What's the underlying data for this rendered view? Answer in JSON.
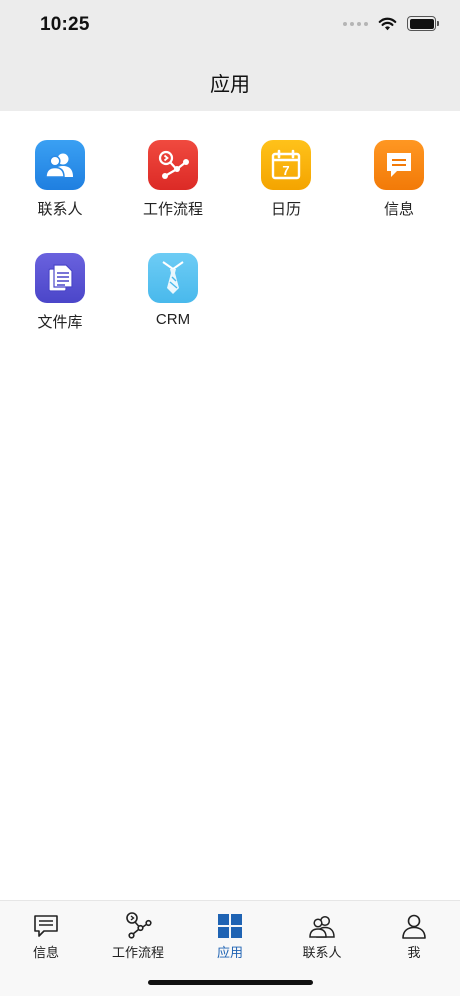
{
  "status_bar": {
    "time": "10:25"
  },
  "header": {
    "title": "应用"
  },
  "apps": [
    {
      "label": "联系人",
      "icon": "contacts-icon",
      "color": "#2f8ee8"
    },
    {
      "label": "工作流程",
      "icon": "workflow-icon",
      "color": "#e8322e"
    },
    {
      "label": "日历",
      "icon": "calendar-icon",
      "color": "#f7b500",
      "calendar_day": "7"
    },
    {
      "label": "信息",
      "icon": "message-icon",
      "color": "#f7860f"
    },
    {
      "label": "文件库",
      "icon": "document-library-icon",
      "color": "#5a55d3"
    },
    {
      "label": "CRM",
      "icon": "crm-tie-icon",
      "color": "#5bc5f1"
    }
  ],
  "tabbar": {
    "active_color": "#1f63b3",
    "items": [
      {
        "label": "信息",
        "icon": "message-icon"
      },
      {
        "label": "工作流程",
        "icon": "workflow-icon"
      },
      {
        "label": "应用",
        "icon": "apps-grid-icon",
        "active": true
      },
      {
        "label": "联系人",
        "icon": "contacts-icon"
      },
      {
        "label": "我",
        "icon": "person-icon"
      }
    ]
  }
}
